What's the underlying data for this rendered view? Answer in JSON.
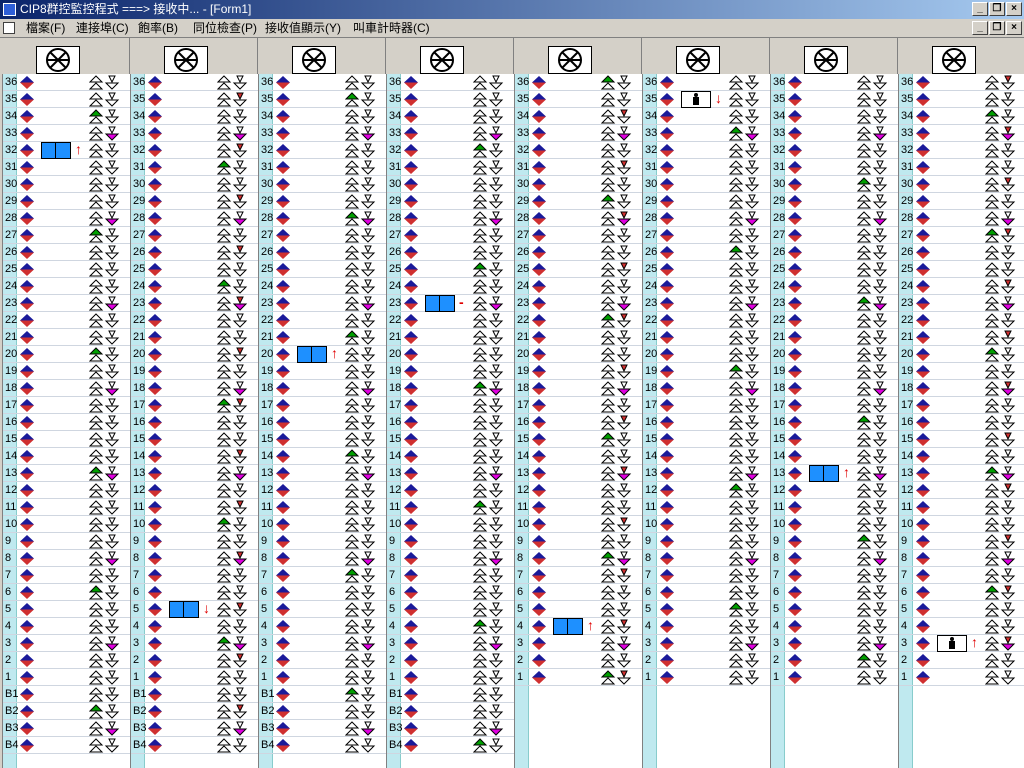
{
  "window": {
    "title": "CIP8群控監控程式 ===> 接收中... - [Form1]"
  },
  "menu": [
    "檔案(F)",
    "連接埠(C)",
    "飽率(B)",
    "同位檢查(P)",
    "接收值顯示(Y)",
    "叫車計時器(C)"
  ],
  "floors_main": [
    "36",
    "35",
    "34",
    "33",
    "32",
    "31",
    "30",
    "29",
    "28",
    "27",
    "26",
    "25",
    "24",
    "23",
    "22",
    "21",
    "20",
    "19",
    "18",
    "17",
    "16",
    "15",
    "14",
    "13",
    "12",
    "11",
    "10",
    "9",
    "8",
    "7",
    "6",
    "5",
    "4",
    "3",
    "2",
    "1"
  ],
  "basement": [
    "B1",
    "B2",
    "B3",
    "B4"
  ],
  "colors": {
    "titlebar": "#0a246a",
    "strip": "#bfe9ef",
    "car": "#1e90ff",
    "arrow": "#e00000",
    "hall_up": "#1a1a9a",
    "hall_down": "#d03030",
    "call_up": "#00a000",
    "call_down": "#e000e0"
  },
  "elevators": [
    {
      "id": 1,
      "car_floor": "32",
      "car_type": "door",
      "direction": "↑",
      "has_basement": true
    },
    {
      "id": 2,
      "car_floor": "5",
      "car_type": "door",
      "direction": "↓",
      "has_basement": true
    },
    {
      "id": 3,
      "car_floor": "20",
      "car_type": "door",
      "direction": "↑",
      "has_basement": true
    },
    {
      "id": 4,
      "car_floor": "23",
      "car_type": "door",
      "direction": "-",
      "has_basement": true
    },
    {
      "id": 5,
      "car_floor": "4",
      "car_type": "door",
      "direction": "↑",
      "has_basement": false
    },
    {
      "id": 6,
      "car_floor": "35",
      "car_type": "person",
      "direction": "↓",
      "has_basement": false
    },
    {
      "id": 7,
      "car_floor": "13",
      "car_type": "door",
      "direction": "↑",
      "has_basement": false
    },
    {
      "id": 8,
      "car_floor": "3",
      "car_type": "person",
      "direction": "↑",
      "has_basement": false
    }
  ]
}
